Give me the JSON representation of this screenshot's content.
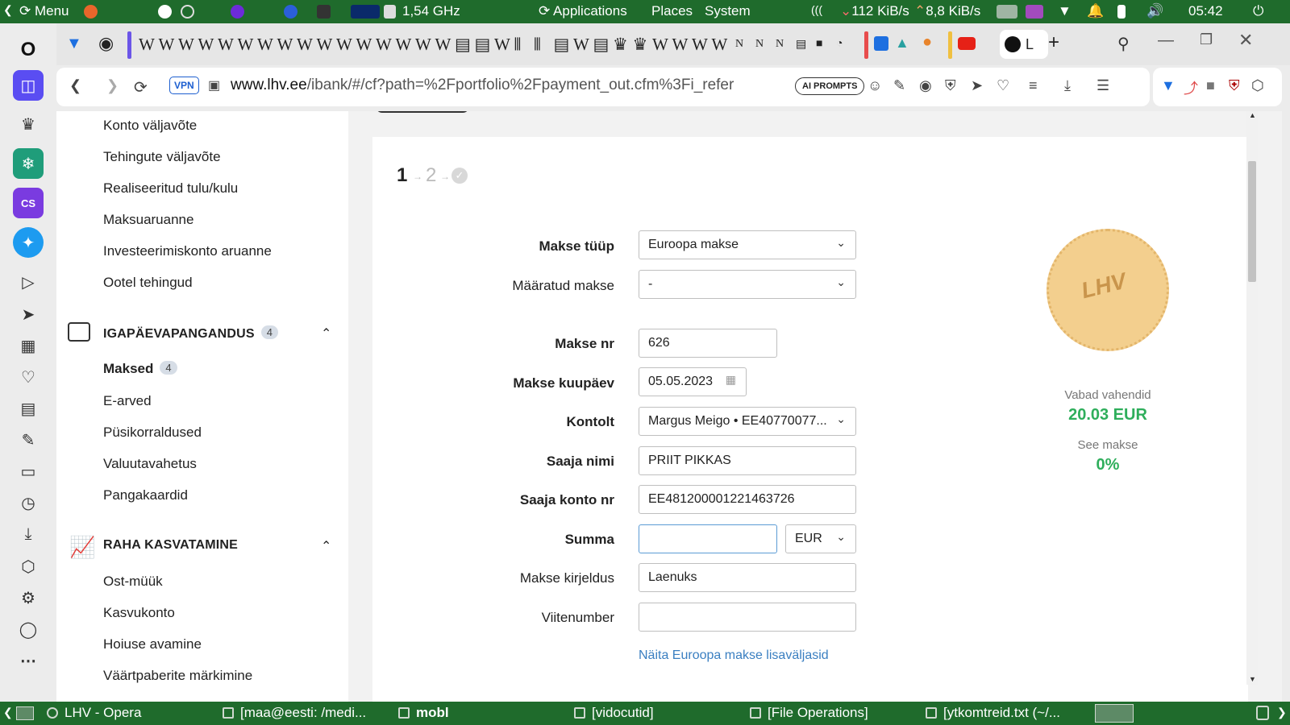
{
  "system_top": {
    "menu_label": "Menu",
    "cpu_freq": "1,54 GHz",
    "applications": "Applications",
    "places": "Places",
    "system": "System",
    "net_down": "112 KiB/s",
    "net_up": "8,8 KiB/s",
    "clock": "05:42"
  },
  "taskbar": {
    "items": [
      "LHV - Opera",
      "[maa@eesti: /medi...",
      "mobl",
      "[vidocutid]",
      "[File Operations]",
      "[ytkomtreid.txt (~/..."
    ]
  },
  "browser": {
    "vpn_label": "VPN",
    "url_domain": "www.lhv.ee",
    "url_path": "/ibank/#/cf?path=%2Fportfolio%2Fpayment_out.cfm%3Fi_refer",
    "ai_prompts_label": "AI PROMPTS",
    "active_tab_label": "L"
  },
  "left_nav": {
    "items_top": [
      "Konto väljavõte",
      "Tehingute väljavõte",
      "Realiseeritud tulu/kulu",
      "Maksuaruanne",
      "Investeerimiskonto aruanne",
      "Ootel tehingud"
    ],
    "section1": {
      "title": "IGAPÄEVAPANGANDUS",
      "count": "4"
    },
    "items_mid_active": {
      "label": "Maksed",
      "count": "4"
    },
    "items_mid": [
      "E-arved",
      "Püsikorraldused",
      "Valuutavahetus",
      "Pangakaardid"
    ],
    "section2": {
      "title": "RAHA KASVATAMINE"
    },
    "items_bottom": [
      "Ost-müük",
      "Kasvukonto",
      "Hoiuse avamine",
      "Väärtpaberite märkimine"
    ]
  },
  "steps": {
    "step1": "1",
    "step2": "2"
  },
  "form": {
    "makse_tuup": {
      "label": "Makse tüüp",
      "value": "Euroopa makse"
    },
    "maaratud_makse": {
      "label": "Määratud makse",
      "value": "-"
    },
    "makse_nr": {
      "label": "Makse nr",
      "value": "626"
    },
    "makse_kuupaev": {
      "label": "Makse kuupäev",
      "value": "05.05.2023"
    },
    "kontolt": {
      "label": "Kontolt",
      "value": "Margus Meigo • EE40770077..."
    },
    "saaja_nimi": {
      "label": "Saaja nimi",
      "value": "PRIIT PIKKAS"
    },
    "saaja_konto": {
      "label": "Saaja konto nr",
      "value": "EE481200001221463726"
    },
    "summa": {
      "label": "Summa",
      "value": "",
      "currency": "EUR"
    },
    "kirjeldus": {
      "label": "Makse kirjeldus",
      "value": "Laenuks"
    },
    "viitenumber": {
      "label": "Viitenumber",
      "value": ""
    },
    "extra_link": "Näita Euroopa makse lisaväljasid"
  },
  "side_info": {
    "logo_text": "LHV",
    "free_funds_label": "Vabad vahendid",
    "free_funds_value": "20.03 EUR",
    "see_makse_label": "See makse",
    "see_makse_value": "0%"
  },
  "colors": {
    "accent_green": "#2eae5b",
    "link_blue": "#3a7fc1",
    "system_bar": "#1f6b2c"
  }
}
